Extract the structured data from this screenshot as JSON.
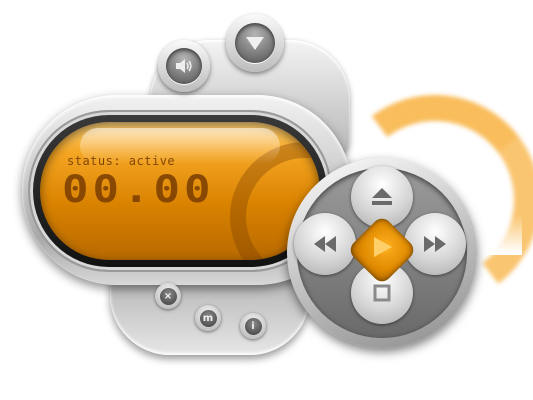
{
  "player": {
    "display": {
      "status": "status: active",
      "time": "00.00"
    },
    "colors": {
      "accent": "#f5a623",
      "chrome": "#c4c4c4",
      "screen_text": "#7a3c00"
    },
    "icons": {
      "volume": "speaker-icon",
      "menu": "triangle-down-icon",
      "eject": "eject-icon",
      "rewind": "rewind-icon",
      "play": "play-icon",
      "forward": "fast-forward-icon",
      "stop": "stop-icon",
      "close": "close-icon",
      "minimize": "minimize-icon",
      "info": "info-icon"
    },
    "small_buttons": {
      "close": "×",
      "minimize": "m",
      "info": "i"
    }
  }
}
